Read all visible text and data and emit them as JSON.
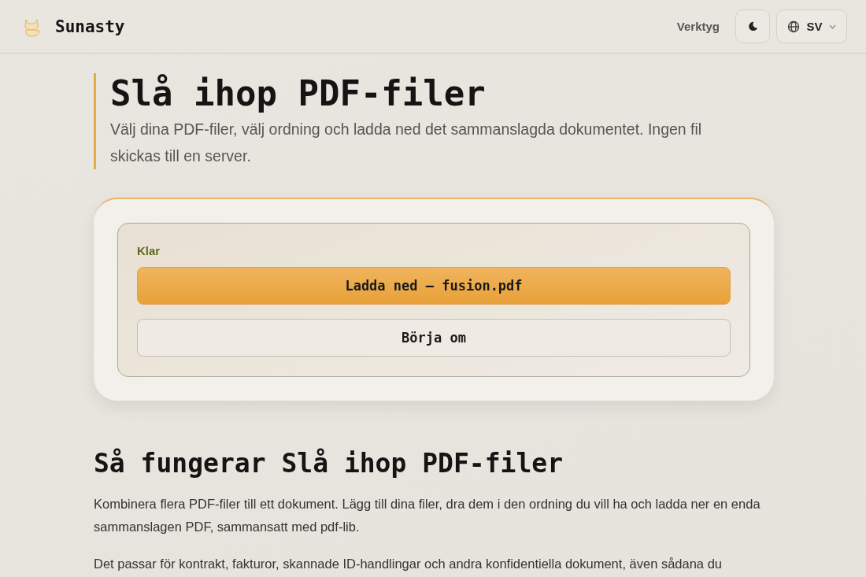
{
  "header": {
    "brand": "Sunasty",
    "nav": [
      {
        "label": "Verktyg"
      }
    ],
    "language": "SV"
  },
  "hero": {
    "title": "Slå ihop PDF-filer",
    "subtitle": "Välj dina PDF-filer, välj ordning och ladda ned det sammanslagda dokumentet. Ingen fil skickas till en server."
  },
  "result": {
    "status": "Klar",
    "buttons": [
      {
        "label": "Ladda ned — fusion.pdf",
        "kind": "primary"
      },
      {
        "label": "Börja om",
        "kind": "secondary"
      }
    ]
  },
  "about": {
    "heading": "Så fungerar Slå ihop PDF-filer",
    "paragraphs": [
      "Kombinera flera PDF-filer till ett dokument. Lägg till dina filer, dra dem i den ordning du vill ha och ladda ner en enda sammanslagen PDF, sammansatt med pdf-lib.",
      "Det passar för kontrakt, fakturor, skannade ID-handlingar och andra konfidentiella dokument, även sådana du"
    ]
  }
}
